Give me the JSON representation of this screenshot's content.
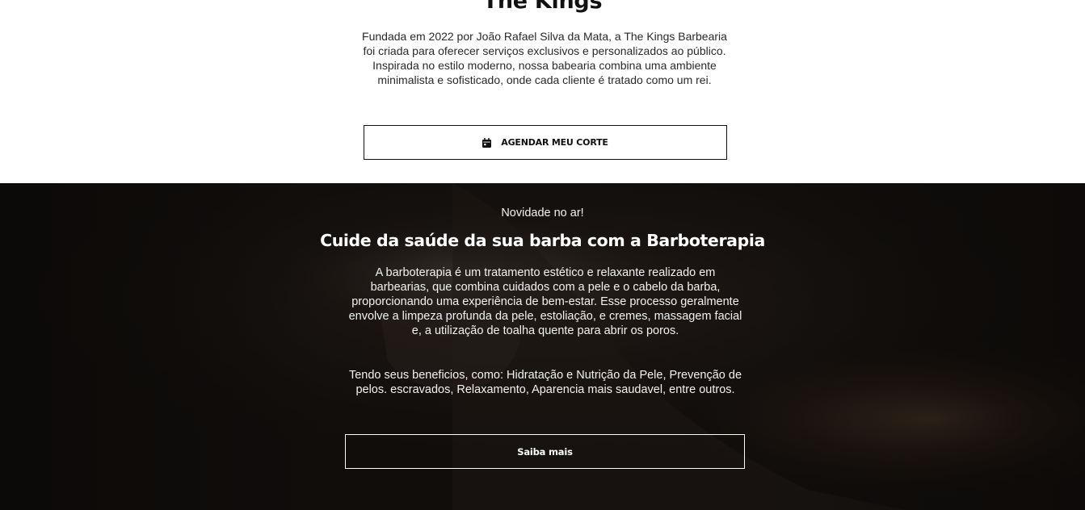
{
  "about": {
    "title": "The Kings",
    "description": "Fundada em 2022 por João Rafael Silva da Mata, a The Kings Barbearia foi criada para oferecer serviços exclusivos e personalizados ao público. Inspirada no estilo moderno, nossa babearia combina uma ambiente minimalista e sofisticado, onde cada cliente é tratado como um rei.",
    "cta_label": "AGENDAR MEU CORTE",
    "cta_icon": "calendar-icon"
  },
  "barboterapia": {
    "kicker": "Novidade no ar!",
    "title": "Cuide da saúde da sua barba com a Barboterapia",
    "paragraph1": "A barboterapia é um tratamento estético e relaxante realizado em barbearias, que combina cuidados com a pele e o cabelo da barba, proporcionando uma experiência de bem-estar. Esse processo geralmente envolve a limpeza profunda da pele, estoliação, e cremes, massagem facial e, a utilização de toalha quente para abrir os poros.",
    "paragraph2": "Tendo seus beneficios, como: Hidratação e Nutrição da Pele, Prevenção de pelos. escravados, Relaxamento, Aparencia mais saudavel, entre outros.",
    "cta_label": "Saiba mais"
  },
  "colors": {
    "accent": "#111111",
    "dark_section_bg": "#120e0c",
    "light_text": "#ffffff"
  }
}
